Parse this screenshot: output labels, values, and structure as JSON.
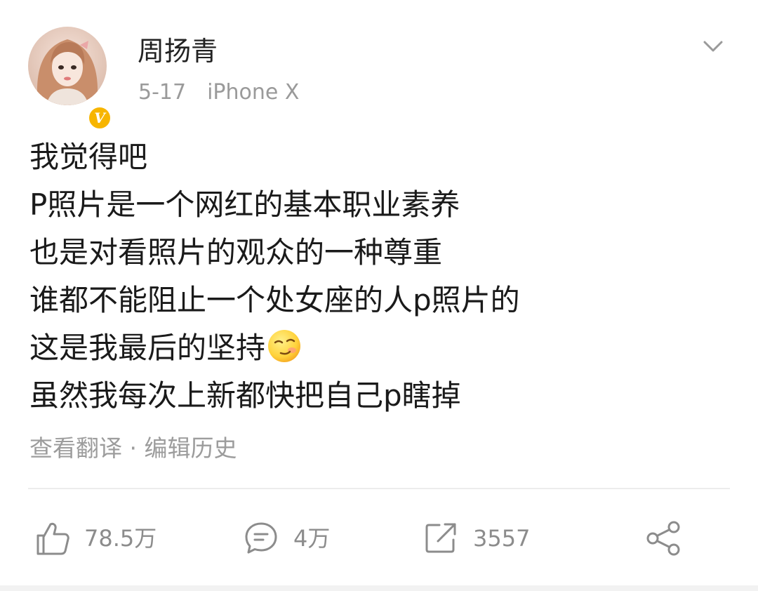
{
  "post": {
    "author": {
      "name": "周扬青",
      "avatar_icon": "user-avatar",
      "verified_badge": "V"
    },
    "meta": {
      "date": "5-17",
      "device": "iPhone X"
    },
    "menu_icon": "chevron-down-icon",
    "content_lines": [
      "我觉得吧",
      "P照片是一个网红的基本职业素养",
      "也是对看照片的观众的一种尊重",
      "谁都不能阻止一个处女座的人p照片的",
      "这是我最后的坚持",
      "虽然我每次上新都快把自己p瞎掉"
    ],
    "inline_emoji": "smirk-emoji",
    "links": {
      "translate": "查看翻译",
      "separator": "·",
      "edit_history": "编辑历史"
    },
    "actions": {
      "likes": "78.5万",
      "comments": "4万",
      "reposts": "3557"
    },
    "colors": {
      "text": "#1a1a1a",
      "muted": "#9a9a9a",
      "icon": "#8c8c8c",
      "badge": "#f7b500",
      "divider": "#ececec"
    }
  }
}
